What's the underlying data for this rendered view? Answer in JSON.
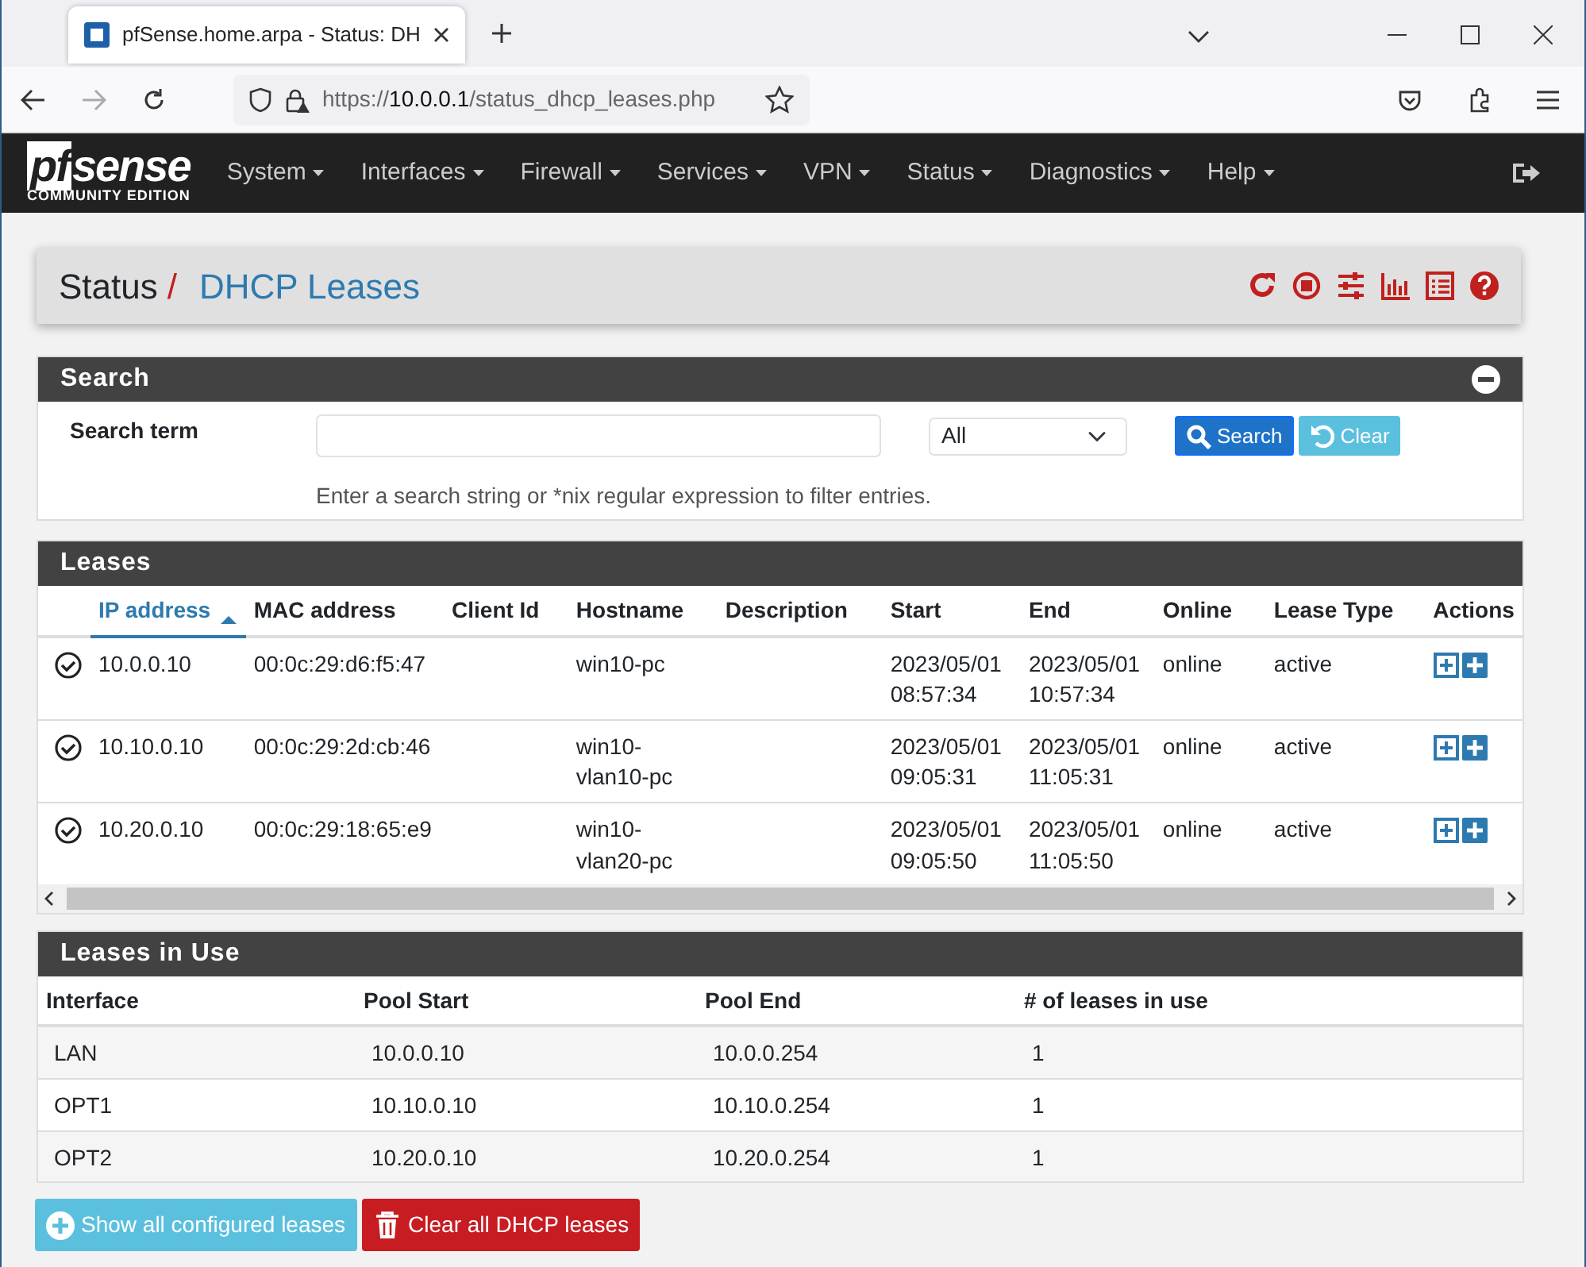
{
  "browser": {
    "tab_title": "pfSense.home.arpa - Status: DH",
    "url_scheme": "https://",
    "url_host": "10.0.0.1",
    "url_path": "/status_dhcp_leases.php"
  },
  "navbar": {
    "brand_pf": "pf",
    "brand_sense": "sense",
    "brand_edition": "COMMUNITY EDITION",
    "menus": [
      "System",
      "Interfaces",
      "Firewall",
      "Services",
      "VPN",
      "Status",
      "Diagnostics",
      "Help"
    ]
  },
  "breadcrumb": {
    "parent": "Status",
    "separator": "/",
    "current": "DHCP Leases"
  },
  "search": {
    "title": "Search",
    "label": "Search term",
    "select_value": "All",
    "search_button": "Search",
    "clear_button": "Clear",
    "help": "Enter a search string or *nix regular expression to filter entries."
  },
  "leases": {
    "title": "Leases",
    "columns": [
      {
        "label": "IP address",
        "sorted": true
      },
      {
        "label": "MAC address",
        "sorted": false
      },
      {
        "label": "Client Id",
        "sorted": false
      },
      {
        "label": "Hostname",
        "sorted": false
      },
      {
        "label": "Description",
        "sorted": false
      },
      {
        "label": "Start",
        "sorted": false
      },
      {
        "label": "End",
        "sorted": false
      },
      {
        "label": "Online",
        "sorted": false
      },
      {
        "label": "Lease Type",
        "sorted": false
      },
      {
        "label": "Actions",
        "sorted": false
      }
    ],
    "rows": [
      {
        "ip": "10.0.0.10",
        "mac": "00:0c:29:d6:f5:47",
        "hostname": "win10-pc",
        "start": "2023/05/01 08:57:34",
        "end": "2023/05/01 10:57:34",
        "online": "online",
        "type": "active"
      },
      {
        "ip": "10.10.0.10",
        "mac": "00:0c:29:2d:cb:46",
        "hostname": "win10-vlan10-pc",
        "start": "2023/05/01 09:05:31",
        "end": "2023/05/01 11:05:31",
        "online": "online",
        "type": "active"
      },
      {
        "ip": "10.20.0.10",
        "mac": "00:0c:29:18:65:e9",
        "hostname": "win10-vlan20-pc",
        "start": "2023/05/01 09:05:50",
        "end": "2023/05/01 11:05:50",
        "online": "online",
        "type": "active"
      }
    ]
  },
  "pools": {
    "title": "Leases in Use",
    "columns": [
      "Interface",
      "Pool Start",
      "Pool End",
      "# of leases in use"
    ],
    "rows": [
      [
        "LAN",
        "10.0.0.10",
        "10.0.0.254",
        "1"
      ],
      [
        "OPT1",
        "10.10.0.10",
        "10.10.0.254",
        "1"
      ],
      [
        "OPT2",
        "10.20.0.10",
        "10.20.0.254",
        "1"
      ]
    ]
  },
  "footer_buttons": [
    {
      "label": "Show all configured leases",
      "kind": "info"
    },
    {
      "label": "Clear all DHCP leases",
      "kind": "danger"
    }
  ]
}
